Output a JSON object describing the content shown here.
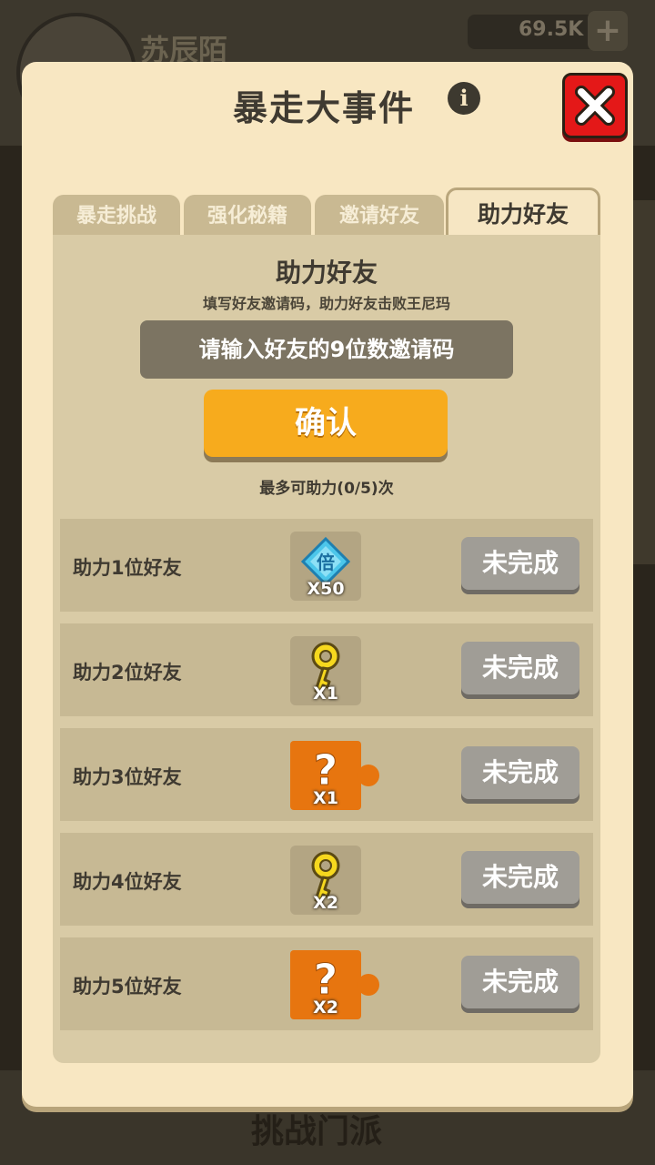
{
  "background": {
    "player_name": "苏辰陌",
    "coins": "69.5K",
    "coins_plus": "+",
    "bottom_label": "挑战门派"
  },
  "modal": {
    "title": "暴走大事件",
    "info_glyph": "i"
  },
  "tabs": [
    {
      "label": "暴走挑战",
      "active": false
    },
    {
      "label": "强化秘籍",
      "active": false
    },
    {
      "label": "邀请好友",
      "active": false
    },
    {
      "label": "助力好友",
      "active": true
    }
  ],
  "assist": {
    "title": "助力好友",
    "description": "填写好友邀请码，助力好友击败王尼玛",
    "input_placeholder": "请输入好友的9位数邀请码",
    "input_value": "",
    "confirm_label": "确认",
    "count_text": "最多可助力(0/5)次"
  },
  "rewards": [
    {
      "label": "助力1位好友",
      "icon": "double-exp-gem-icon",
      "count": "X50",
      "status": "未完成"
    },
    {
      "label": "助力2位好友",
      "icon": "gold-key-icon",
      "count": "X1",
      "status": "未完成"
    },
    {
      "label": "助力3位好友",
      "icon": "mystery-puzzle-icon",
      "count": "X1",
      "status": "未完成"
    },
    {
      "label": "助力4位好友",
      "icon": "gold-key-icon",
      "count": "X2",
      "status": "未完成"
    },
    {
      "label": "助力5位好友",
      "icon": "mystery-puzzle-icon",
      "count": "X2",
      "status": "未完成"
    }
  ],
  "gem_glyph": "倍",
  "question_glyph": "?"
}
